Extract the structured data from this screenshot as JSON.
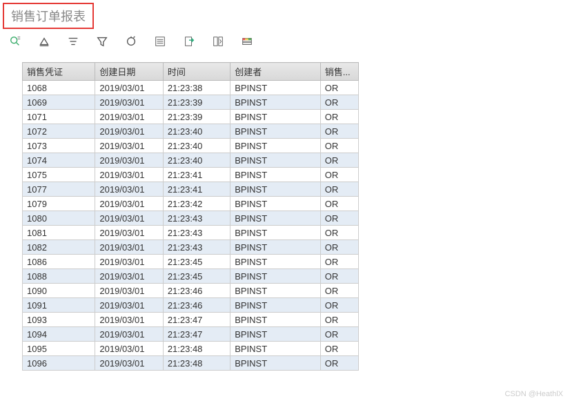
{
  "title": "销售订单报表",
  "toolbar": [
    {
      "name": "detail-icon"
    },
    {
      "name": "sort-asc-icon"
    },
    {
      "name": "sort-desc-icon"
    },
    {
      "name": "filter-icon"
    },
    {
      "name": "refresh-icon"
    },
    {
      "name": "sum-icon"
    },
    {
      "name": "export-icon"
    },
    {
      "name": "layout-icon"
    },
    {
      "name": "grid-icon"
    }
  ],
  "columns": [
    "销售凭证",
    "创建日期",
    "时间",
    "创建者",
    "销售..."
  ],
  "rows": [
    {
      "doc": "1068",
      "date": "2019/03/01",
      "time": "21:23:38",
      "creator": "BPINST",
      "type": "OR"
    },
    {
      "doc": "1069",
      "date": "2019/03/01",
      "time": "21:23:39",
      "creator": "BPINST",
      "type": "OR"
    },
    {
      "doc": "1071",
      "date": "2019/03/01",
      "time": "21:23:39",
      "creator": "BPINST",
      "type": "OR"
    },
    {
      "doc": "1072",
      "date": "2019/03/01",
      "time": "21:23:40",
      "creator": "BPINST",
      "type": "OR"
    },
    {
      "doc": "1073",
      "date": "2019/03/01",
      "time": "21:23:40",
      "creator": "BPINST",
      "type": "OR"
    },
    {
      "doc": "1074",
      "date": "2019/03/01",
      "time": "21:23:40",
      "creator": "BPINST",
      "type": "OR"
    },
    {
      "doc": "1075",
      "date": "2019/03/01",
      "time": "21:23:41",
      "creator": "BPINST",
      "type": "OR"
    },
    {
      "doc": "1077",
      "date": "2019/03/01",
      "time": "21:23:41",
      "creator": "BPINST",
      "type": "OR"
    },
    {
      "doc": "1079",
      "date": "2019/03/01",
      "time": "21:23:42",
      "creator": "BPINST",
      "type": "OR"
    },
    {
      "doc": "1080",
      "date": "2019/03/01",
      "time": "21:23:43",
      "creator": "BPINST",
      "type": "OR"
    },
    {
      "doc": "1081",
      "date": "2019/03/01",
      "time": "21:23:43",
      "creator": "BPINST",
      "type": "OR"
    },
    {
      "doc": "1082",
      "date": "2019/03/01",
      "time": "21:23:43",
      "creator": "BPINST",
      "type": "OR"
    },
    {
      "doc": "1086",
      "date": "2019/03/01",
      "time": "21:23:45",
      "creator": "BPINST",
      "type": "OR"
    },
    {
      "doc": "1088",
      "date": "2019/03/01",
      "time": "21:23:45",
      "creator": "BPINST",
      "type": "OR"
    },
    {
      "doc": "1090",
      "date": "2019/03/01",
      "time": "21:23:46",
      "creator": "BPINST",
      "type": "OR"
    },
    {
      "doc": "1091",
      "date": "2019/03/01",
      "time": "21:23:46",
      "creator": "BPINST",
      "type": "OR"
    },
    {
      "doc": "1093",
      "date": "2019/03/01",
      "time": "21:23:47",
      "creator": "BPINST",
      "type": "OR"
    },
    {
      "doc": "1094",
      "date": "2019/03/01",
      "time": "21:23:47",
      "creator": "BPINST",
      "type": "OR"
    },
    {
      "doc": "1095",
      "date": "2019/03/01",
      "time": "21:23:48",
      "creator": "BPINST",
      "type": "OR"
    },
    {
      "doc": "1096",
      "date": "2019/03/01",
      "time": "21:23:48",
      "creator": "BPINST",
      "type": "OR"
    }
  ],
  "watermark": "CSDN @HeathlX"
}
